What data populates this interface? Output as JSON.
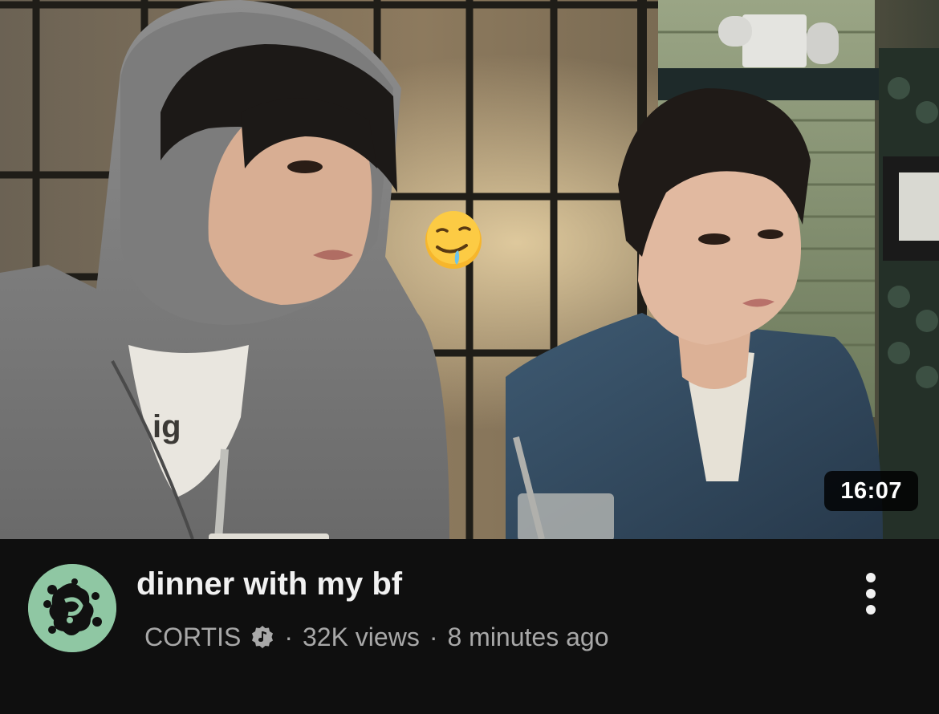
{
  "video": {
    "title": "dinner with my bf",
    "duration": "16:07",
    "channel": "CORTIS",
    "separator": "·",
    "views": "32K views",
    "uploaded": "8 minutes ago",
    "channel_verified": true,
    "thumbnail_sticker": "drooling-face-emoji"
  },
  "colors": {
    "background": "#0f0f0f",
    "title": "#f1f1f1",
    "secondary_text": "#a8a8a8",
    "avatar_bg": "#8fc7a3",
    "avatar_mark": "#111111",
    "badge_bg": "#000000"
  },
  "icons": {
    "verified": "music-verified-icon",
    "more": "vertical-ellipsis-icon"
  }
}
